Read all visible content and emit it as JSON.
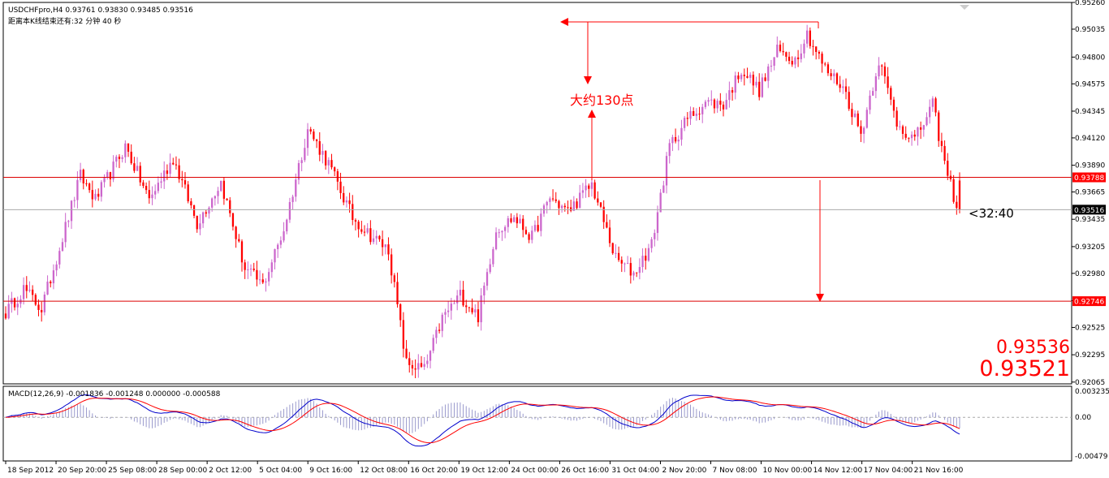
{
  "window": {
    "symbol_info": "USDCHFpro,H4  0.93761 0.93830 0.93485 0.93516",
    "countdown_info": "距离本K线结束还有:32 分钟 40 秒",
    "countdown_marker": "<32:40",
    "bid_large": "0.93536",
    "ask_large": "0.93521"
  },
  "annotation": {
    "label": "大约130点"
  },
  "levels": {
    "resistance_label": "0.93788",
    "support_label": "0.92746",
    "current_label": "0.93516",
    "resistance": 0.93788,
    "support": 0.92746,
    "current": 0.93516
  },
  "colors": {
    "bull_candle": "#cc66cc",
    "bear_candle": "#ff0000",
    "level_line": "#dd0000",
    "macd_line": "#0000cc",
    "signal_line": "#ff0000",
    "histogram": "#9999cc",
    "axis_text": "#000000",
    "background": "#ffffff"
  },
  "macd": {
    "label": "MACD(12,26,9) -0.001836 -0.001248 0.000000 -0.000588",
    "y_ticks": [
      "0.003235",
      "0.00",
      "-0.00479"
    ]
  },
  "chart_data": [
    {
      "type": "candlestick",
      "symbol": "USDCHFpro",
      "timeframe": "H4",
      "ylim": [
        0.9205,
        0.9526
      ],
      "y_ticks": [
        "0.95260",
        "0.95035",
        "0.94800",
        "0.94575",
        "0.94345",
        "0.94120",
        "0.93890",
        "0.93665",
        "0.93435",
        "0.93205",
        "0.92980",
        "0.92750",
        "0.92525",
        "0.92295",
        "0.92065"
      ],
      "x_ticks": [
        "18 Sep 2012",
        "20 Sep 20:00",
        "25 Sep 08:00",
        "28 Sep 00:00",
        "2 Oct 12:00",
        "5 Oct 04:00",
        "9 Oct 16:00",
        "12 Oct 08:00",
        "16 Oct 20:00",
        "19 Oct 12:00",
        "24 Oct 00:00",
        "26 Oct 16:00",
        "31 Oct 04:00",
        "2 Nov 20:00",
        "7 Nov 08:00",
        "10 Nov 00:00",
        "14 Nov 12:00",
        "17 Nov 04:00",
        "21 Nov 16:00"
      ],
      "anchors": [
        {
          "i": 0,
          "p": 0.9265
        },
        {
          "i": 6,
          "p": 0.9285
        },
        {
          "i": 12,
          "p": 0.9268
        },
        {
          "i": 25,
          "p": 0.938
        },
        {
          "i": 30,
          "p": 0.936
        },
        {
          "i": 40,
          "p": 0.9405
        },
        {
          "i": 48,
          "p": 0.936
        },
        {
          "i": 56,
          "p": 0.9395
        },
        {
          "i": 64,
          "p": 0.934
        },
        {
          "i": 72,
          "p": 0.9375
        },
        {
          "i": 80,
          "p": 0.9302
        },
        {
          "i": 86,
          "p": 0.9288
        },
        {
          "i": 93,
          "p": 0.9335
        },
        {
          "i": 101,
          "p": 0.942
        },
        {
          "i": 108,
          "p": 0.939
        },
        {
          "i": 116,
          "p": 0.9345
        },
        {
          "i": 122,
          "p": 0.933
        },
        {
          "i": 128,
          "p": 0.9318
        },
        {
          "i": 134,
          "p": 0.9222
        },
        {
          "i": 140,
          "p": 0.9217
        },
        {
          "i": 146,
          "p": 0.926
        },
        {
          "i": 152,
          "p": 0.928
        },
        {
          "i": 158,
          "p": 0.9262
        },
        {
          "i": 164,
          "p": 0.9335
        },
        {
          "i": 170,
          "p": 0.9345
        },
        {
          "i": 176,
          "p": 0.9328
        },
        {
          "i": 182,
          "p": 0.9362
        },
        {
          "i": 188,
          "p": 0.935
        },
        {
          "i": 196,
          "p": 0.9373
        },
        {
          "i": 204,
          "p": 0.931
        },
        {
          "i": 210,
          "p": 0.9298
        },
        {
          "i": 216,
          "p": 0.9322
        },
        {
          "i": 222,
          "p": 0.9405
        },
        {
          "i": 228,
          "p": 0.9428
        },
        {
          "i": 234,
          "p": 0.9442
        },
        {
          "i": 240,
          "p": 0.944
        },
        {
          "i": 246,
          "p": 0.947
        },
        {
          "i": 252,
          "p": 0.9452
        },
        {
          "i": 258,
          "p": 0.9485
        },
        {
          "i": 264,
          "p": 0.9478
        },
        {
          "i": 268,
          "p": 0.95
        },
        {
          "i": 274,
          "p": 0.947
        },
        {
          "i": 280,
          "p": 0.9455
        },
        {
          "i": 286,
          "p": 0.9415
        },
        {
          "i": 292,
          "p": 0.9478
        },
        {
          "i": 298,
          "p": 0.9425
        },
        {
          "i": 304,
          "p": 0.941
        },
        {
          "i": 310,
          "p": 0.944
        },
        {
          "i": 314,
          "p": 0.939
        },
        {
          "i": 318,
          "p": 0.9355
        }
      ],
      "last_bar": {
        "open": 0.93761,
        "high": 0.9383,
        "low": 0.93485,
        "close": 0.93516
      }
    }
  ]
}
